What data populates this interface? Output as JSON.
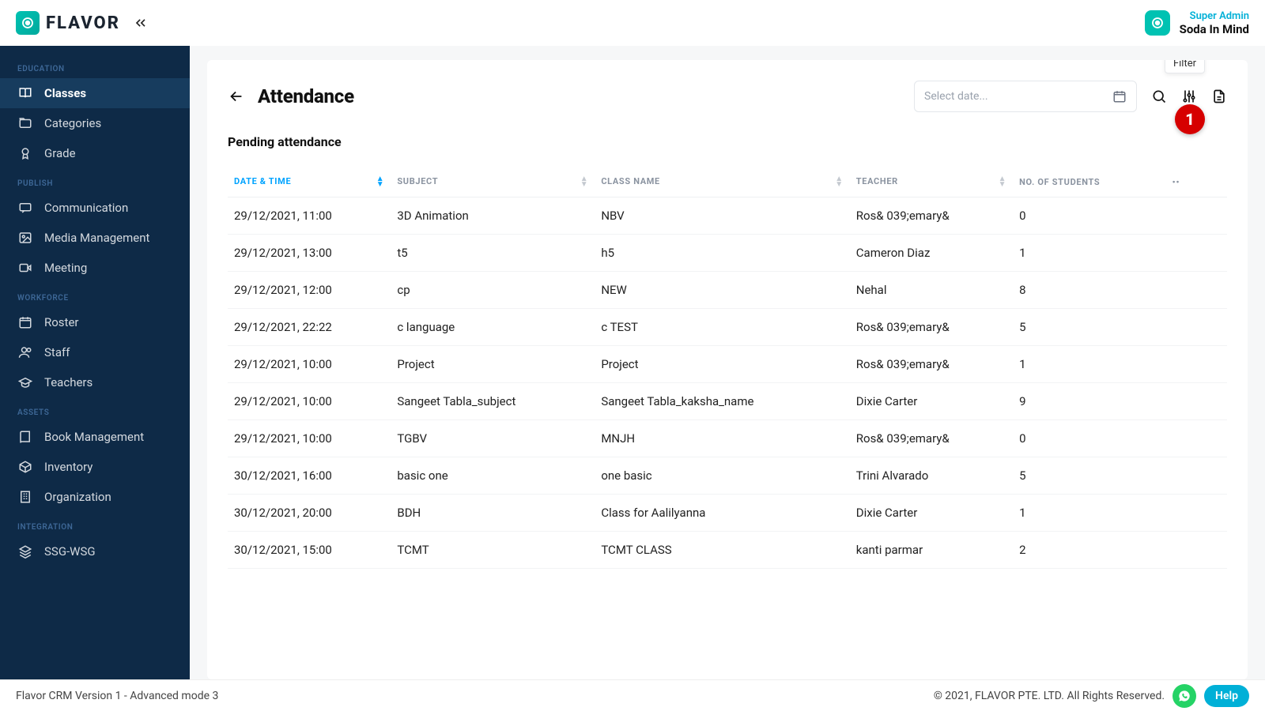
{
  "brand": {
    "name": "FLAVOR"
  },
  "user": {
    "role": "Super Admin",
    "name": "Soda In Mind"
  },
  "sidebar": {
    "sections": [
      {
        "label": "EDUCATION",
        "items": [
          {
            "label": "Classes",
            "icon": "book-open",
            "active": true
          },
          {
            "label": "Categories",
            "icon": "folder"
          },
          {
            "label": "Grade",
            "icon": "award"
          }
        ]
      },
      {
        "label": "PUBLISH",
        "items": [
          {
            "label": "Communication",
            "icon": "message"
          },
          {
            "label": "Media Management",
            "icon": "image"
          },
          {
            "label": "Meeting",
            "icon": "video"
          }
        ]
      },
      {
        "label": "WORKFORCE",
        "items": [
          {
            "label": "Roster",
            "icon": "calendar"
          },
          {
            "label": "Staff",
            "icon": "users"
          },
          {
            "label": "Teachers",
            "icon": "teacher"
          }
        ]
      },
      {
        "label": "ASSETS",
        "items": [
          {
            "label": "Book Management",
            "icon": "book"
          },
          {
            "label": "Inventory",
            "icon": "box"
          },
          {
            "label": "Organization",
            "icon": "building"
          }
        ]
      },
      {
        "label": "INTEGRATION",
        "items": [
          {
            "label": "SSG-WSG",
            "icon": "layers"
          }
        ]
      }
    ]
  },
  "page": {
    "title": "Attendance",
    "date_placeholder": "Select date...",
    "tooltip": "Filter",
    "callout": "1",
    "subheading": "Pending attendance"
  },
  "table": {
    "columns": [
      {
        "label": "DATE & TIME",
        "sortable": true,
        "active": true
      },
      {
        "label": "SUBJECT",
        "sortable": true
      },
      {
        "label": "CLASS NAME",
        "sortable": true
      },
      {
        "label": "TEACHER",
        "sortable": true
      },
      {
        "label": "NO. OF STUDENTS",
        "sortable": false
      }
    ],
    "rows": [
      {
        "date": "29/12/2021, 11:00",
        "subject": "3D Animation",
        "class": "NBV",
        "teacher": "Ros& 039;emary&",
        "count": "0"
      },
      {
        "date": "29/12/2021, 13:00",
        "subject": "t5",
        "class": "h5",
        "teacher": "Cameron Diaz",
        "count": "1"
      },
      {
        "date": "29/12/2021, 12:00",
        "subject": "cp",
        "class": "NEW",
        "teacher": "Nehal",
        "count": "8"
      },
      {
        "date": "29/12/2021, 22:22",
        "subject": "c language",
        "class": "c TEST",
        "teacher": "Ros& 039;emary&",
        "count": "5"
      },
      {
        "date": "29/12/2021, 10:00",
        "subject": "Project",
        "class": "Project",
        "teacher": "Ros& 039;emary&",
        "count": "1"
      },
      {
        "date": "29/12/2021, 10:00",
        "subject": "Sangeet Tabla_subject",
        "class": "Sangeet Tabla_kaksha_name",
        "teacher": "Dixie Carter",
        "count": "9"
      },
      {
        "date": "29/12/2021, 10:00",
        "subject": "TGBV",
        "class": "MNJH",
        "teacher": "Ros& 039;emary&",
        "count": "0"
      },
      {
        "date": "30/12/2021, 16:00",
        "subject": "basic one",
        "class": "one basic",
        "teacher": "Trini Alvarado",
        "count": "5"
      },
      {
        "date": "30/12/2021, 20:00",
        "subject": "BDH",
        "class": "Class for Aalilyanna",
        "teacher": "Dixie Carter",
        "count": "1"
      },
      {
        "date": "30/12/2021, 15:00",
        "subject": "TCMT",
        "class": "TCMT CLASS",
        "teacher": "kanti parmar",
        "count": "2"
      }
    ]
  },
  "footer": {
    "left": "Flavor CRM Version 1 - Advanced mode 3",
    "right": "© 2021, FLAVOR PTE. LTD. All Rights Reserved.",
    "help": "Help"
  }
}
